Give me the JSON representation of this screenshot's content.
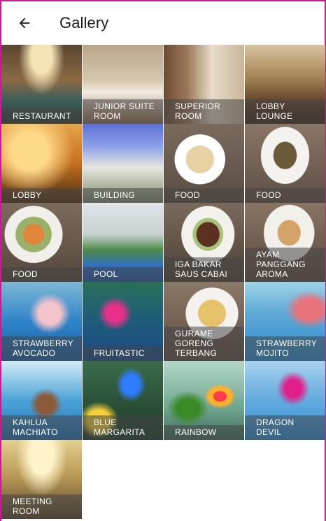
{
  "appbar": {
    "title": "Gallery",
    "back_icon": "arrow-left-icon"
  },
  "gallery": {
    "items": [
      {
        "id": "restaurant",
        "label": "RESTAURANT"
      },
      {
        "id": "junior",
        "label": "JUNIOR SUITE\nROOM"
      },
      {
        "id": "superior",
        "label": "SUPERIOR\nROOM"
      },
      {
        "id": "lobby-lounge",
        "label": "LOBBY\nLOUNGE"
      },
      {
        "id": "lobby",
        "label": "LOBBY"
      },
      {
        "id": "building",
        "label": "BUILDING"
      },
      {
        "id": "food-a",
        "label": "FOOD"
      },
      {
        "id": "food-b",
        "label": "FOOD"
      },
      {
        "id": "food-c",
        "label": "FOOD"
      },
      {
        "id": "pool",
        "label": "POOL"
      },
      {
        "id": "iga",
        "label": "IGA BAKAR\nSAUS CABAI"
      },
      {
        "id": "ayam",
        "label": "AYAM\nPANGGANG\nAROMA"
      },
      {
        "id": "straw-avo",
        "label": "STRAWBERRY\nAVOCADO"
      },
      {
        "id": "fruitastic",
        "label": "FRUITASTIC"
      },
      {
        "id": "gurame",
        "label": "GURAME\nGORENG\nTERBANG"
      },
      {
        "id": "straw-mojito",
        "label": "STRAWBERRY\nMOJITO"
      },
      {
        "id": "kahlua",
        "label": "KAHLUA\nMACHIATO"
      },
      {
        "id": "blue-marg",
        "label": "BLUE\nMARGARITA"
      },
      {
        "id": "rainbow",
        "label": "RAINBOW"
      },
      {
        "id": "dragon",
        "label": "DRAGON\nDEVIL"
      },
      {
        "id": "meeting",
        "label": "MEETING\nROOM"
      }
    ]
  }
}
